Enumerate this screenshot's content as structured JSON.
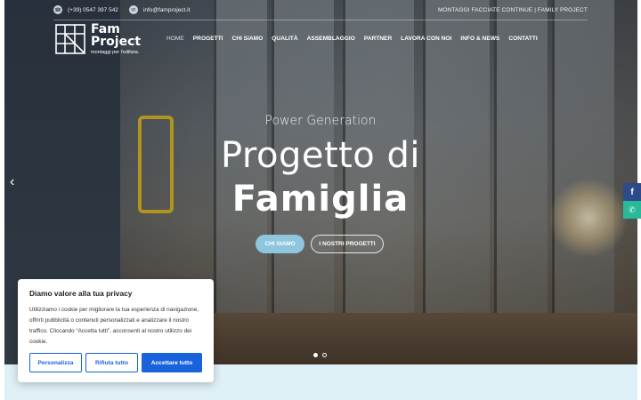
{
  "topbar": {
    "phone": "(+39) 0547 397 542",
    "email": "info@famproject.it",
    "right_text": "MONTAGGI FACCIATE CONTINUE | FAMILY PROJECT",
    "phone_icon": "phone-icon",
    "email_icon": "mail-icon"
  },
  "logo": {
    "line1": "Fam",
    "line2": "Project",
    "tagline": "montaggi per l'edilizia."
  },
  "nav": {
    "items": [
      {
        "label": "HOME"
      },
      {
        "label": "PROGETTI"
      },
      {
        "label": "CHI SIAMO"
      },
      {
        "label": "QUALITÀ"
      },
      {
        "label": "ASSEMBLAGGIO"
      },
      {
        "label": "PARTNER"
      },
      {
        "label": "LAVORA CON NOI"
      },
      {
        "label": "INFO & NEWS"
      },
      {
        "label": "CONTATTI"
      }
    ]
  },
  "hero": {
    "subtitle": "Power Generation",
    "title_line1": "Progetto di",
    "title_line2": "Famiglia",
    "cta_primary": "CHI SIAMO",
    "cta_secondary": "I NOSTRI PROGETTI",
    "slides_total": 2,
    "active_slide": 1,
    "prev_arrow": "‹"
  },
  "social": {
    "facebook": "f",
    "whatsapp": "✆"
  },
  "cookie": {
    "title": "Diamo valore alla tua privacy",
    "body": "Utilizziamo i cookie per migliorare la tua esperienza di navigazione, offrirti pubblicità o contenuti personalizzati e analizzare il nostro traffico. Cliccando “Accetta tutti”, acconsenti al nostro utilizzo dei cookie.",
    "customize": "Personalizza",
    "reject": "Rifiuta tutto",
    "accept": "Accettare tutto"
  },
  "colors": {
    "accent": "#8ec6dd",
    "cookie_blue": "#1863dc",
    "facebook": "#2d4a8a",
    "whatsapp": "#27b99a",
    "strip": "#dff0f7"
  }
}
